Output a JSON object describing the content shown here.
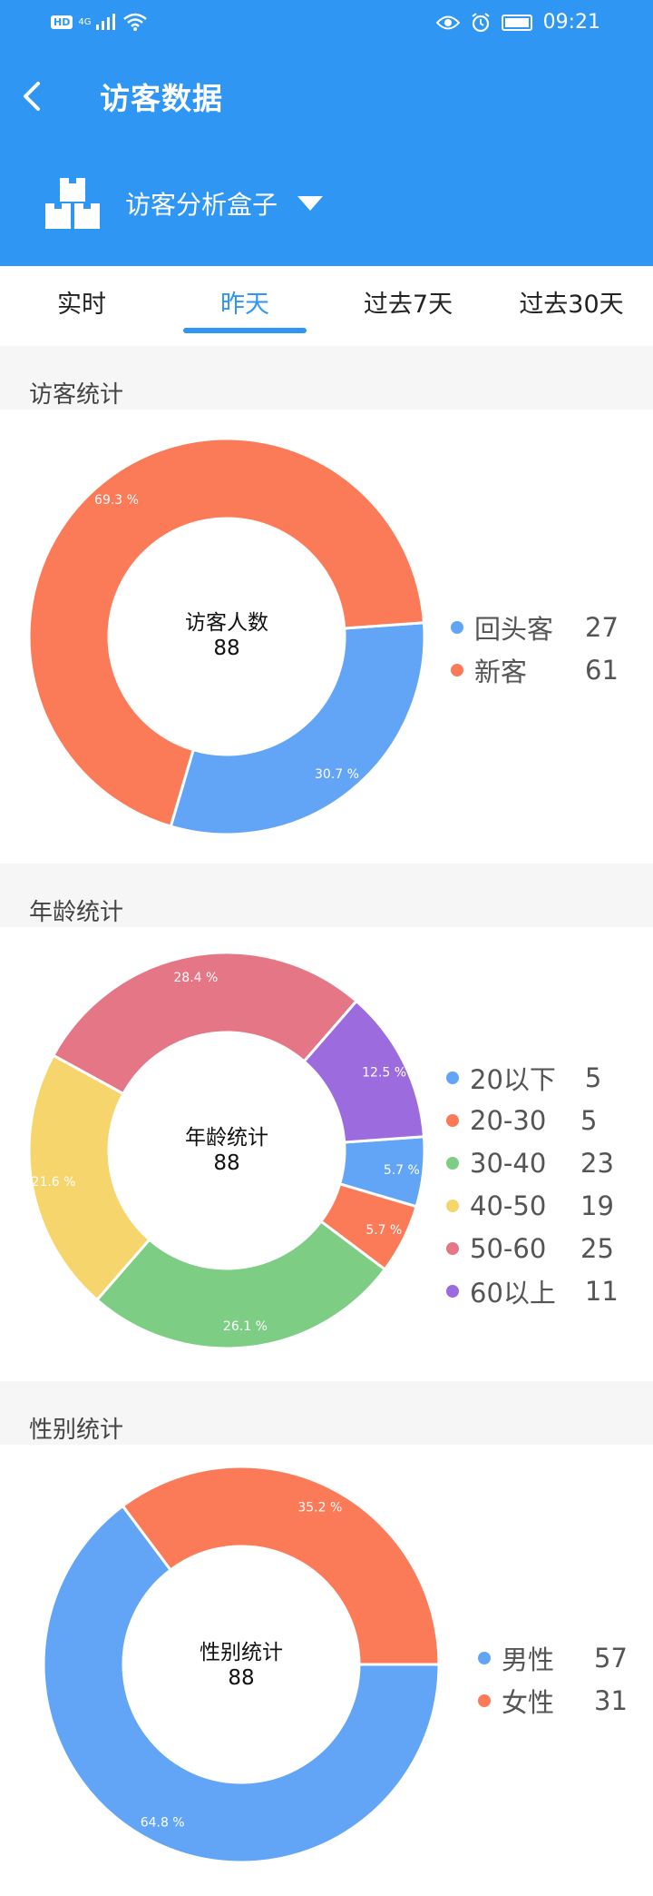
{
  "status_bar": {
    "time": "09:21",
    "network": "4G",
    "hd_label": "HD"
  },
  "header": {
    "title": "访客数据",
    "selector_label": "访客分析盒子"
  },
  "tabs": [
    {
      "label": "实时",
      "active": false
    },
    {
      "label": "昨天",
      "active": true
    },
    {
      "label": "过去7天",
      "active": false
    },
    {
      "label": "过去30天",
      "active": false
    }
  ],
  "colors": {
    "primary": "#2f96f3",
    "blue": "#62a5f6",
    "orange": "#fb7a58",
    "green": "#7ecd85",
    "yellow": "#f6d56c",
    "pink": "#e47686",
    "purple": "#9c6cdf"
  },
  "visitors": {
    "section_title": "访客统计",
    "center_label": "访客人数",
    "center_value": "88",
    "legend": [
      {
        "label": "回头客",
        "value": "27",
        "color": "#62a5f6"
      },
      {
        "label": "新客",
        "value": "61",
        "color": "#fb7a58"
      }
    ],
    "chart_data": {
      "type": "pie",
      "categories": [
        "回头客",
        "新客"
      ],
      "values": [
        27,
        61
      ],
      "data_labels": [
        "30.7 %",
        "69.3 %"
      ]
    }
  },
  "age": {
    "section_title": "年龄统计",
    "center_label": "年龄统计",
    "center_value": "88",
    "legend": [
      {
        "label": "20以下",
        "value": "5",
        "color": "#62a5f6"
      },
      {
        "label": "20-30",
        "value": "5",
        "color": "#fb7a58"
      },
      {
        "label": "30-40",
        "value": "23",
        "color": "#7ecd85"
      },
      {
        "label": "40-50",
        "value": "19",
        "color": "#f6d56c"
      },
      {
        "label": "50-60",
        "value": "25",
        "color": "#e47686"
      },
      {
        "label": "60以上",
        "value": "11",
        "color": "#9c6cdf"
      }
    ],
    "chart_data": {
      "type": "pie",
      "categories": [
        "20以下",
        "20-30",
        "30-40",
        "40-50",
        "50-60",
        "60以上"
      ],
      "values": [
        5,
        5,
        23,
        19,
        25,
        11
      ],
      "data_labels": [
        "5.7 %",
        "5.7 %",
        "26.1 %",
        "21.6 %",
        "28.4 %",
        "12.5 %"
      ]
    }
  },
  "gender": {
    "section_title": "性别统计",
    "center_label": "性别统计",
    "center_value": "88",
    "legend": [
      {
        "label": "男性",
        "value": "57",
        "color": "#62a5f6"
      },
      {
        "label": "女性",
        "value": "31",
        "color": "#fb7a58"
      }
    ],
    "chart_data": {
      "type": "pie",
      "categories": [
        "男性",
        "女性"
      ],
      "values": [
        57,
        31
      ],
      "data_labels": [
        "64.8 %",
        "35.2 %"
      ]
    }
  }
}
